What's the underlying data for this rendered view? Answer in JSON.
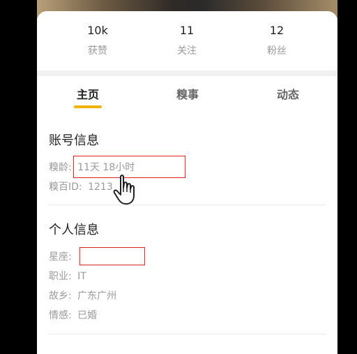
{
  "stats": [
    {
      "value": "10k",
      "label": "获赞"
    },
    {
      "value": "11",
      "label": "关注"
    },
    {
      "value": "12",
      "label": "粉丝"
    }
  ],
  "tabs": [
    "主页",
    "糗事",
    "动态"
  ],
  "account": {
    "title": "账号信息",
    "age_label": "糗龄:",
    "age_value": "11天 18小时",
    "id_label": "糗百ID:",
    "id_value": "1213"
  },
  "personal": {
    "title": "个人信息",
    "rows": [
      {
        "label": "星座:",
        "value": ""
      },
      {
        "label": "职业:",
        "value": "IT"
      },
      {
        "label": "故乡:",
        "value": "广东广州"
      },
      {
        "label": "情感:",
        "value": "已婚"
      }
    ]
  },
  "colors": {
    "tab_indicator": "#f2b400",
    "highlight_box": "#e02020"
  },
  "icons": {
    "cursor": "pointing-hand-icon"
  }
}
